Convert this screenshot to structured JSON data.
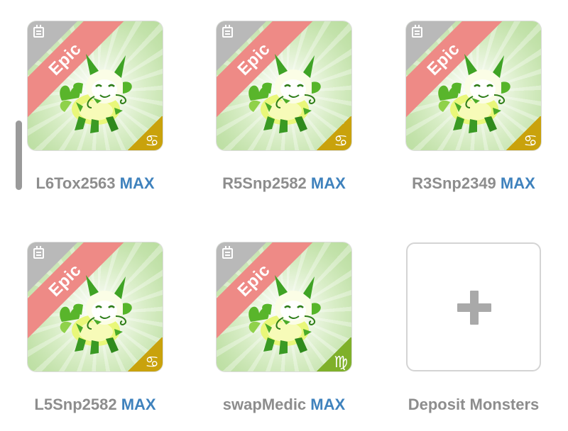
{
  "ribbon_label": "Epic",
  "items": [
    {
      "name": "L6Tox2563",
      "level": "MAX",
      "sign": "♋",
      "sign_icon": "cancer-icon",
      "sign_color": "#c9a20c"
    },
    {
      "name": "R5Snp2582",
      "level": "MAX",
      "sign": "♋",
      "sign_icon": "cancer-icon",
      "sign_color": "#c9a20c"
    },
    {
      "name": "R3Snp2349",
      "level": "MAX",
      "sign": "♋",
      "sign_icon": "cancer-icon",
      "sign_color": "#c9a20c"
    },
    {
      "name": "L5Snp2582",
      "level": "MAX",
      "sign": "♋",
      "sign_icon": "cancer-icon",
      "sign_color": "#c9a20c"
    },
    {
      "name": "swapMedic",
      "level": "MAX",
      "sign": "♍",
      "sign_icon": "virgo-icon",
      "sign_color": "#7fb02a"
    }
  ],
  "deposit": {
    "label": "Deposit Monsters",
    "icon": "plus-icon"
  },
  "colors": {
    "max": "#3f82bd",
    "ribbon": "#ee8a86",
    "name": "#8d8d8d"
  }
}
